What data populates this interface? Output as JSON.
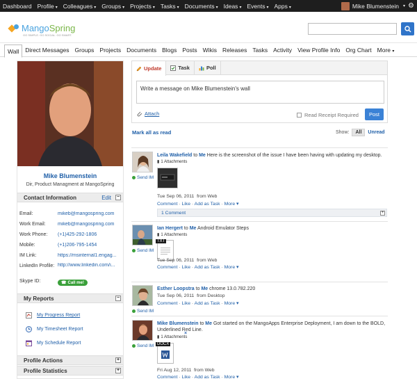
{
  "top_nav": {
    "items": [
      {
        "label": "Dashboard",
        "caret": false
      },
      {
        "label": "Profile",
        "caret": true
      },
      {
        "label": "Colleagues",
        "caret": true
      },
      {
        "label": "Groups",
        "caret": true
      },
      {
        "label": "Projects",
        "caret": true
      },
      {
        "label": "Tasks",
        "caret": true
      },
      {
        "label": "Documents",
        "caret": true
      },
      {
        "label": "Ideas",
        "caret": true
      },
      {
        "label": "Events",
        "caret": true
      },
      {
        "label": "Apps",
        "caret": true
      }
    ],
    "user_name": "Mike Blumenstein",
    "caret": "▾",
    "gear": "⚙"
  },
  "brand": {
    "logo_primary": "Mango",
    "logo_secondary": "Spring",
    "tagline": "GO SIMPLE. GO SOCIAL. GO SMART."
  },
  "search": {
    "placeholder": "",
    "button_icon": "search-icon"
  },
  "sub_nav": {
    "tabs": [
      "Wall",
      "Direct Messages",
      "Groups",
      "Projects",
      "Documents",
      "Blogs",
      "Posts",
      "Wikis",
      "Releases",
      "Tasks",
      "Activity",
      "View Profile Info",
      "Org Chart"
    ],
    "more_label": "More",
    "more_caret": "▾"
  },
  "profile": {
    "name": "Mike Blumenstein",
    "title": "Dir, Product Managment at MangoSpring",
    "contact_header": "Contact Information",
    "edit_label": "Edit",
    "toggle_minus": "−",
    "toggle_plus": "+",
    "contact": [
      {
        "label": "Email:",
        "value": "mikeb@mangospring.com"
      },
      {
        "label": "Work Email:",
        "value": "mikeb@mangospring.com"
      },
      {
        "label": "Work Phone:",
        "value": "(+1)425-292-1806"
      },
      {
        "label": "Mobile:",
        "value": "(+1)206-795-1454"
      },
      {
        "label": "IM Link:",
        "value": "https://msinternal1.engag..."
      },
      {
        "label": "LinkedIn Profile:",
        "value": "http://www.linkedin.com/i..."
      },
      {
        "label": "Skype ID:",
        "value": ""
      }
    ],
    "callme_label": "Call me!",
    "reports_header": "My Reports",
    "reports": [
      "My Progress Report",
      "My Timesheet Report",
      "My Schedule Report"
    ],
    "actions_header": "Profile Actions",
    "stats_header": "Profile Statistics"
  },
  "composer": {
    "tabs": [
      "Update",
      "Task",
      "Poll"
    ],
    "placeholder": "Write a message on Mike Blumenstein's wall",
    "attach_label": "Attach",
    "read_receipt_label": "Read Receipt Required",
    "post_label": "Post"
  },
  "feed_controls": {
    "mark_all": "Mark all as read",
    "show_label": "Show:",
    "all_label": "All",
    "unread_label": "Unread"
  },
  "feed": [
    {
      "author": "Leila Wakefield",
      "to_word": "to",
      "target": "Me",
      "text": "Here is the screenshot of the issue I have been having with updating my desktop.",
      "attachments": "1 Attachments",
      "date": "Tue Sep 06, 2011",
      "via": "from Web",
      "comments": "1 Comment",
      "send_im": "Send IM"
    },
    {
      "author": "Ian Hergert",
      "to_word": "to",
      "target": "Me",
      "text": "Android Emulator Steps",
      "attachments": "1 Attachments",
      "doc_type": "TXT",
      "date": "Tue Sep 06, 2011",
      "via": "from Web",
      "send_im": "Send IM"
    },
    {
      "author": "Esther Loopstra",
      "to_word": "to",
      "target": "Me",
      "text": "chrome 13.0.782.220",
      "date": "Tue Sep 06, 2011",
      "via": "from Desktop",
      "send_im": "Send IM"
    },
    {
      "author": "Mike Blumenstein",
      "to_word": "to",
      "target": "Me",
      "text": "Got started on the MangoApps Enterprise Deployment, I am down to the BOLD, Underlined Red Line.",
      "attachments": "1 Attachments",
      "doc_type": "DOCX",
      "date": "Fri Aug 12, 2011",
      "via": "from Web",
      "send_im": "Send IM"
    }
  ],
  "item_actions": {
    "comment": "Comment",
    "like": "Like",
    "add_task": "Add as Task",
    "more": "More",
    "dot": "·",
    "caret": "▾",
    "x": "×"
  }
}
